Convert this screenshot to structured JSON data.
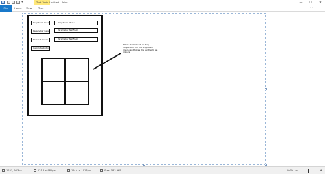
{
  "titlebar": {
    "context_tab": "Text Tools",
    "window_title": "Untitled - Paint",
    "minimize": "—",
    "maximize": "☐",
    "close": "✕",
    "quick_access_more": "▾"
  },
  "ribbon": {
    "file_tab": "File",
    "tabs": [
      "Home",
      "View",
      "Text"
    ],
    "right_icons": "˄ ?"
  },
  "drawing": {
    "labels": [
      "Dropdown Label",
      "Parameter Label",
      "Param 2 Label",
      "Calculate button"
    ],
    "fields": [
      "Dropdown Menu",
      "Parameter TextField",
      "Parameter TextField"
    ],
    "note": "Table that is built on drop dependent on the dropdown menu and takes the textfields as inputs"
  },
  "statusbar": {
    "cursor_position": "1221, 903px",
    "selection_size": "1218 × 981px",
    "canvas_size": "1914 × 1016px",
    "file_size": "Size: 183.9KB",
    "zoom": "100%",
    "zoom_out": "−",
    "zoom_in": "+",
    "zoom_level": 0.5
  }
}
